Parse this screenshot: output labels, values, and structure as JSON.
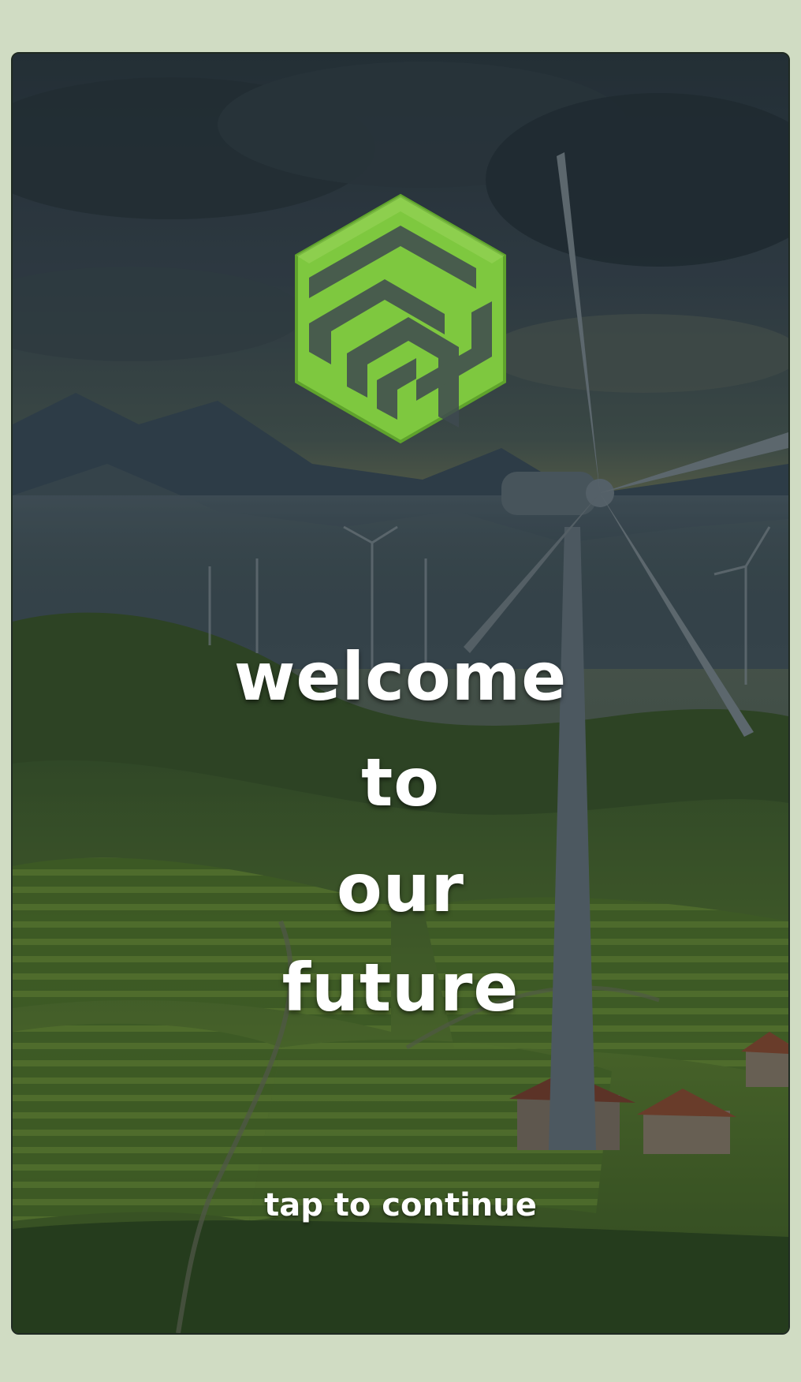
{
  "splash": {
    "headline_line1": "welcome",
    "headline_line2": "to",
    "headline_line3": "our",
    "headline_line4": "future",
    "cta_label": "tap to continue"
  },
  "logo": {
    "icon": "hexagon-maze-logo",
    "color": "#7ec83f"
  },
  "background": {
    "scene": "wind-turbine-landscape",
    "accent_color": "#5a7f2f"
  }
}
